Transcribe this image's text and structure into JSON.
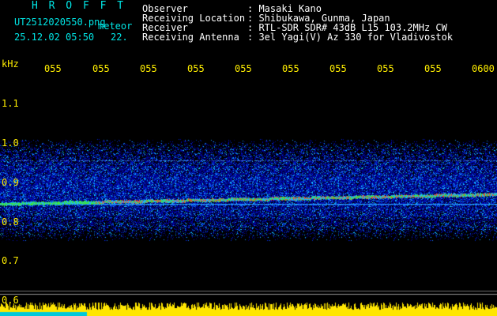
{
  "header": {
    "title": "H R O F F T",
    "filename": "UT2512020550.png",
    "type": "meteor",
    "datetime": "25.12.02 05:50",
    "count": "22.",
    "rows": [
      {
        "label": "Observer",
        "value": ": Masaki Kano"
      },
      {
        "label": "Receiving Location",
        "value": ": Shibukawa, Gunma, Japan"
      },
      {
        "label": "Receiver",
        "value": ": RTL-SDR SDR# 43dB L15 103.2MHz CW"
      },
      {
        "label": "Receiving Antenna",
        "value": ": 3el Yagi(V) Az 330 for Vladivostok"
      }
    ]
  },
  "axis": {
    "unit": "kHz",
    "y_ticks": [
      "1.1",
      "1.0",
      "0.9",
      "0.8",
      "0.7",
      "0.6"
    ],
    "x_ticks": [
      "055",
      "055",
      "055",
      "055",
      "055",
      "055",
      "055",
      "055",
      "055",
      "0600"
    ]
  },
  "colors": {
    "title": "#00e6e6",
    "text": "#ffffff",
    "axis": "#ffee00",
    "background": "#000000"
  }
}
